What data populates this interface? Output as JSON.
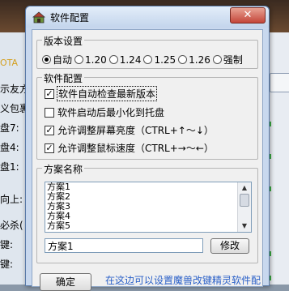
{
  "background": {
    "tag": "OTA",
    "rows": [
      "示友方",
      "义包裹",
      "盘7:",
      "盘4:",
      "盘1:",
      "向上:",
      "必杀(",
      "键:",
      "键:"
    ]
  },
  "window": {
    "title": "软件配置",
    "close_glyph": "✕",
    "version_group": {
      "label": "版本设置",
      "options": [
        "自动",
        "1.20",
        "1.24",
        "1.25",
        "1.26",
        "强制"
      ],
      "selected": "自动"
    },
    "software_group": {
      "label": "软件配置",
      "options": [
        {
          "label": "软件自动检查最新版本",
          "checked": true
        },
        {
          "label": "软件启动后最小化到托盘",
          "checked": false
        },
        {
          "label": "允许调整屏幕亮度（CTRL+↑～↓）",
          "checked": true
        },
        {
          "label": "允许调整鼠标速度（CTRL+→～←）",
          "checked": true
        }
      ]
    },
    "scheme_group": {
      "label": "方案名称",
      "items": [
        "方案1",
        "方案2",
        "方案3",
        "方案4",
        "方案5"
      ],
      "name_value": "方案1",
      "modify_label": "修改"
    },
    "ok_label": "确定",
    "footer_text": "在这边可以设置魔兽改键精灵软件配"
  },
  "colors": {
    "title_gradient_top": "#e3edf9",
    "link": "#2a60c8",
    "close_red": "#c4463a"
  }
}
